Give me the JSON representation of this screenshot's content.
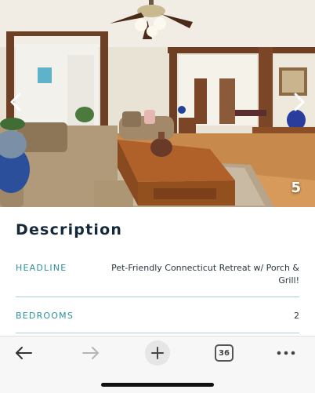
{
  "gallery": {
    "current_photo_number": "5",
    "icons": {
      "prev": "chevron-left-icon",
      "next": "chevron-right-icon"
    }
  },
  "description": {
    "title": "Description",
    "rows": [
      {
        "label": "HEADLINE",
        "value": "Pet-Friendly Connecticut Retreat w/ Porch & Grill!"
      },
      {
        "label": "BEDROOMS",
        "value": "2"
      }
    ]
  },
  "toolbar": {
    "tab_count": "36",
    "icons": {
      "back": "back-arrow-icon",
      "forward": "forward-arrow-icon",
      "new_tab": "plus-icon",
      "tabs": "tabs-icon",
      "more": "more-dots-icon"
    }
  },
  "colors": {
    "accent": "#2b8fa0",
    "title": "#15283a",
    "divider": "#a9cfd6",
    "toolbar_bg": "#f7f7f7"
  }
}
